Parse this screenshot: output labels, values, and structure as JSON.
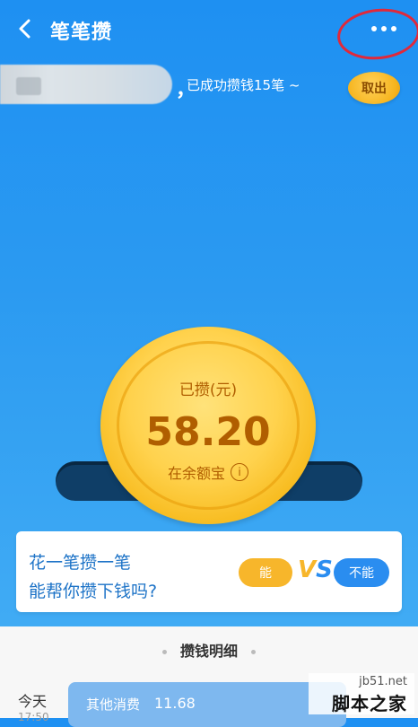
{
  "header": {
    "title": "笔笔攒",
    "back_icon": "chevron-left-icon",
    "more_icon": "more-dots-icon"
  },
  "user_status": {
    "comma": "，",
    "text": "已成功攒钱15笔 ~",
    "withdraw_label": "取出"
  },
  "coin": {
    "label": "已攒(元)",
    "amount": "58.20",
    "location": "在余额宝",
    "info_icon": "i"
  },
  "promo": {
    "line1": "花一笔攒一笔",
    "line2": "能帮你攒下钱吗?",
    "yes_label": "能",
    "vs_v": "V",
    "vs_s": "S",
    "no_label": "不能"
  },
  "detail": {
    "title": "攒钱明细",
    "day": "今天",
    "time": "17:50",
    "record": {
      "category": "其他消费",
      "amount": "11.68"
    }
  },
  "watermark": {
    "url": "jb51.net",
    "text": "脚本之家"
  },
  "colors": {
    "background": "#2b9af1",
    "coin": "#ffd24d",
    "accent_orange": "#f7b62b",
    "accent_blue": "#2a8df0",
    "annotation_red": "#e0293b"
  }
}
